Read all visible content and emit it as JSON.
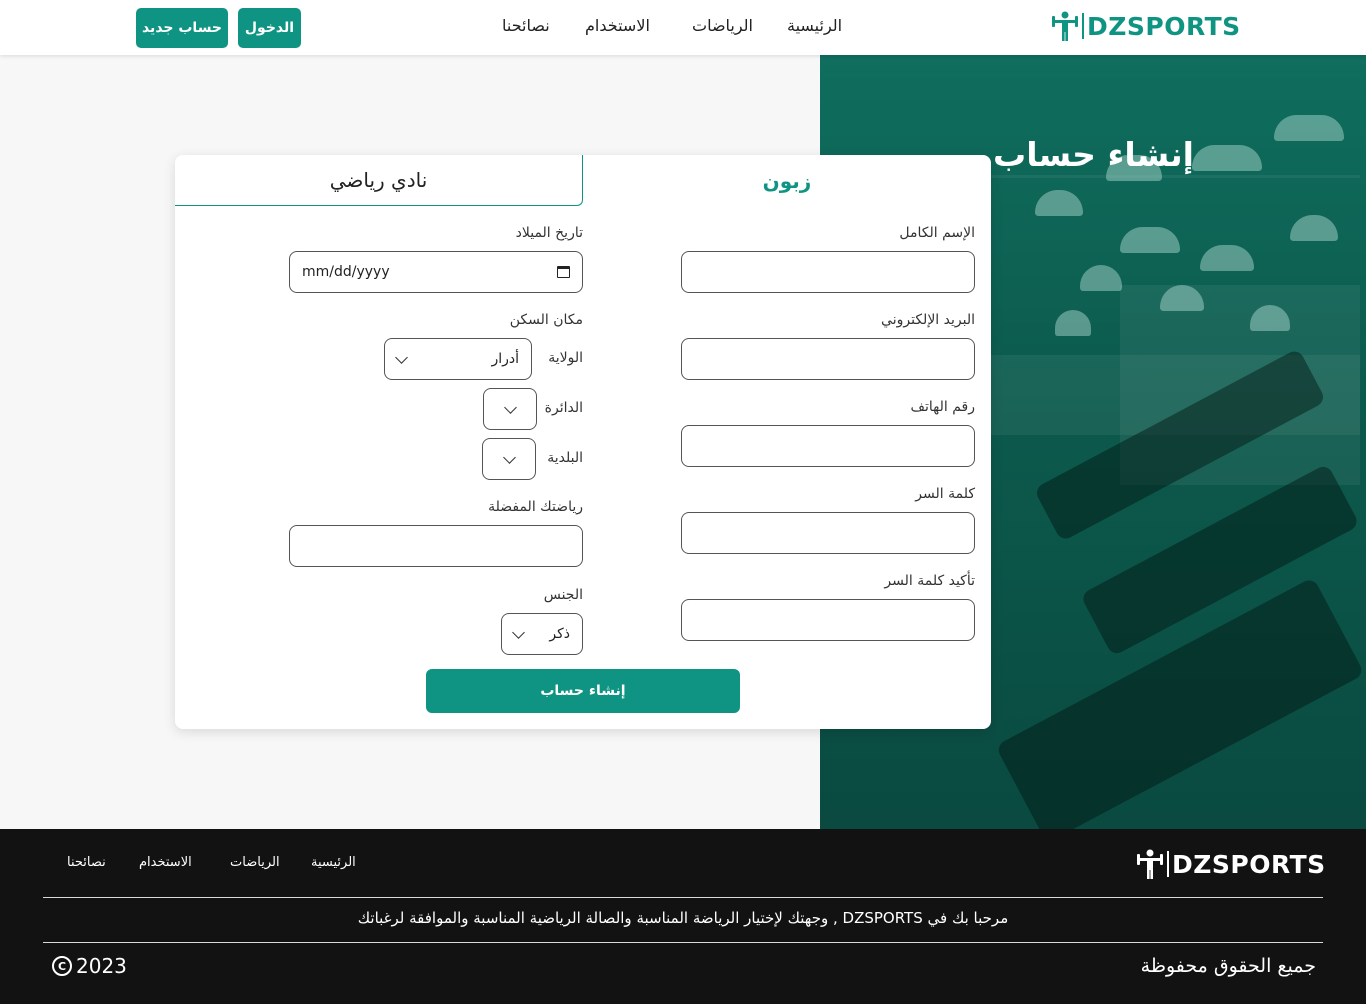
{
  "brand": {
    "name": "DZSPORTS",
    "icon": "athlete-icon",
    "accent": "#0f9483"
  },
  "nav": {
    "home": "الرئيسية",
    "sports": "الرياضات",
    "usage": "الاستخدام",
    "tips": "نصائحنا"
  },
  "auth": {
    "login": "الدخول",
    "signup": "حساب جديد"
  },
  "hero": {
    "title": "إنشاء حساب"
  },
  "form": {
    "tabs": {
      "client": "زبون",
      "club": "نادي رياضي"
    },
    "full_name_label": "الإسم الكامل",
    "email_label": "البريد الإلكتروني",
    "phone_label": "رقم الهاتف",
    "password_label": "كلمة السر",
    "confirm_password_label": "تأكيد كلمة السر",
    "birthdate_label": "تاريخ الميلاد",
    "birthdate_placeholder": "mm/dd/yyyy",
    "residence_label": "مكان السكن",
    "wilaya_label": "الولاية",
    "wilaya_value": "أدرار",
    "daira_label": "الدائرة",
    "daira_value": "",
    "commune_label": "البلدية",
    "commune_value": "",
    "favorite_sport_label": "رياضتك المفضلة",
    "gender_label": "الجنس",
    "gender_value": "ذكر",
    "submit": "إنشاء حساب"
  },
  "footer": {
    "nav": {
      "home": "الرئيسية",
      "sports": "الرياضات",
      "usage": "الاستخدام",
      "tips": "نصائحنا"
    },
    "message": "مرحبا بك في DZSPORTS , وجهتك لإختيار الرياضة المناسبة والصالة الرياضية المناسبة والموافقة لرغباتك",
    "rights": "جميع الحقوق محفوظة",
    "year": "2023",
    "copyright_symbol": "C"
  }
}
